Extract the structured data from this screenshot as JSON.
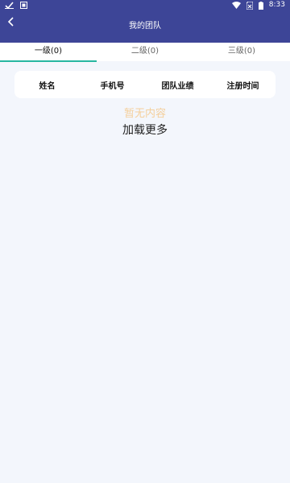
{
  "status_bar": {
    "time": "8:33",
    "left_icons": [
      "check-mail-icon",
      "download-box-icon"
    ],
    "right_icons": [
      "wifi-icon",
      "sim-x-icon",
      "battery-icon"
    ]
  },
  "header": {
    "title": "我的团队",
    "back_icon": "chevron-left-icon",
    "background_color": "#3d4597"
  },
  "tabs": [
    {
      "label": "一级(0)",
      "active": true
    },
    {
      "label": "二级(0)",
      "active": false
    },
    {
      "label": "三级(0)",
      "active": false
    }
  ],
  "tab_indicator_color": "#27b6a0",
  "table": {
    "columns": [
      "姓名",
      "手机号",
      "团队业绩",
      "注册时间"
    ],
    "rows": []
  },
  "empty_state": {
    "text": "暂无内容",
    "color": "#f4cf9b"
  },
  "load_more": {
    "label": "加载更多"
  }
}
